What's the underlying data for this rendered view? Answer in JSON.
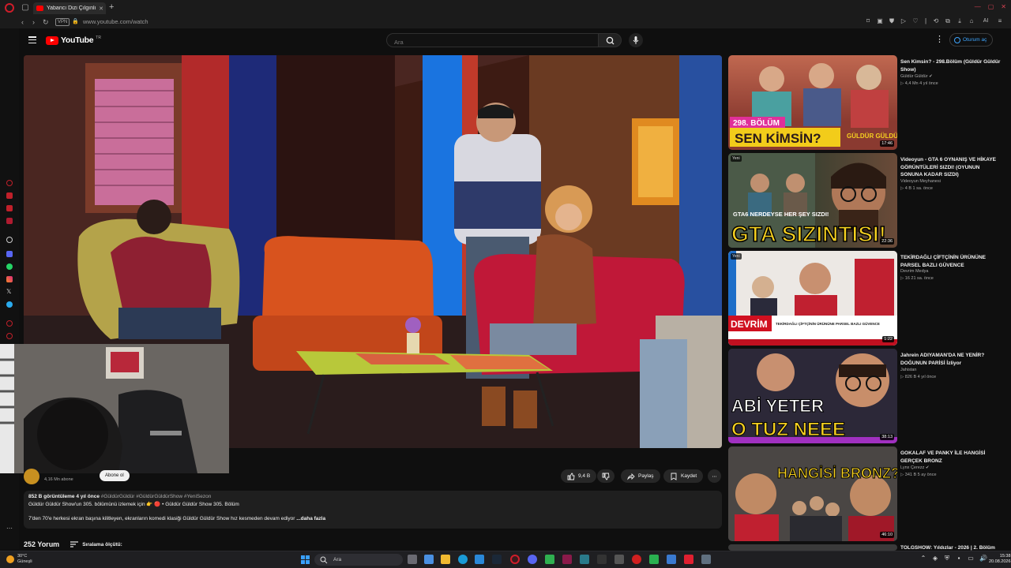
{
  "browser": {
    "tab_title": "Yabancı Dizi Çılgınlığı",
    "url": "www.youtube.com/watch",
    "vpn_label": "VPN",
    "ext_ai_label": "AI"
  },
  "youtube": {
    "logo_text": "YouTube",
    "logo_country": "TR",
    "search_placeholder": "Ara",
    "signin_label": "Oturum aç"
  },
  "video": {
    "channel_name_partial": "Güldür Güldür",
    "channel_subs": "4,16 Mn abone",
    "subscribe_label": "Abone ol",
    "like_count": "9,4 B",
    "share_label": "Paylaş",
    "save_label": "Kaydet",
    "views_date": "852 B görüntüleme  4 yıl önce",
    "hashtags": "#GüldürGüldür #GüldürGüldürShow #YeniSezon",
    "desc_line1": "Güldür Güldür Show'un 305. bölümünü izlemek için 👉 🔴 • Güldür Güldür Show 305. Bölüm",
    "desc_line2": "7'den 70'e herkesi ekran başına kilitleyen, ekranların komedi klasiği Güldür Güldür Show hız kesmeden devam ediyor",
    "more_label": "...daha fazla",
    "comments_count": "252 Yorum",
    "sort_label": "Sıralama ölçütü:"
  },
  "recommendations": [
    {
      "title": "Sen Kimsin? - 298.Bölüm (Güldür Güldür Show)",
      "channel": "Güldür Güldür",
      "stats": "4,4 Mn  4 yıl önce",
      "duration": "17:46",
      "thumb_caption_top": "298. BÖLÜM",
      "thumb_caption": "SEN KİMSİN?",
      "thumb_logo": "GÜLDÜR GÜLDÜR"
    },
    {
      "title": "Videoyun - GTA 6 OYNANIŞ VE HİKAYE GÖRÜNTÜLERİ SIZDI! (OYUNUN SONUNA KADAR SIZDI)",
      "channel": "Videoyun Meyhanesi",
      "stats": "4 B  1 sa. önce",
      "duration": "22:36",
      "badge": "Yeni",
      "thumb_caption_top": "GTA6 NERDEYSE HER ŞEY SIZDI!",
      "thumb_caption": "GTA SIZINTISI!"
    },
    {
      "title": "TEKİRDAĞLI ÇİFTÇİNİN ÜRÜNÜNE PARSEL BAZLI GÜVENCE",
      "channel": "Devrim Medya",
      "stats": "16  21 sa. önce",
      "duration": "1:22",
      "badge": "Yeni",
      "thumb_caption": "DEVRİM",
      "thumb_caption_top": "TEKİRDAĞLI ÇİFTÇİNİN ÜRÜNÜNE PARSEL BAZLI GÜVENCE"
    },
    {
      "title": "Jahrein ADIYAMAN'DA NE YENİR? DOĞUNUN PARİSİ İzliyor",
      "channel": "Jahistan",
      "stats": "826 B  4 yıl önce",
      "duration": "38:13",
      "thumb_caption_top": "ABİ YETER",
      "thumb_caption": "O TUZ NEEE"
    },
    {
      "title": "GOKALAF VE PANKY İLE HANGİSİ GERÇEK BRONZ",
      "channel": "Lynx Çerezz",
      "stats": "341 B  5 ay önce",
      "duration": "46:10",
      "thumb_caption": "HANGİSİ BRONZ?"
    },
    {
      "title": "TOLGSHOW: Yıldızlar - 2026 | 2. Bölüm"
    }
  ],
  "taskbar": {
    "weather_temp": "30°C",
    "weather_desc": "Güneşli",
    "search_label": "Ara",
    "time": "15:38",
    "date": "20.08.2026"
  }
}
